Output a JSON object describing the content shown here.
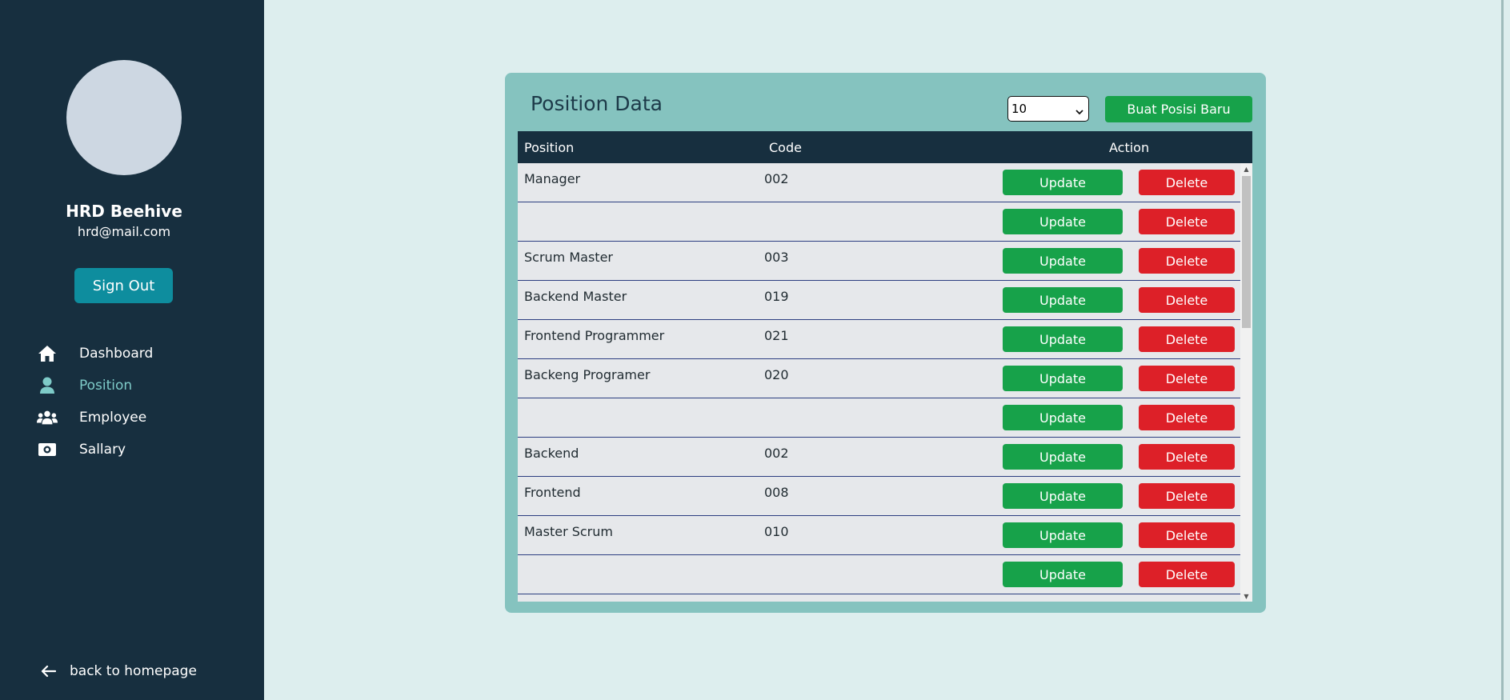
{
  "sidebar": {
    "user_name": "HRD Beehive",
    "user_email": "hrd@mail.com",
    "signout_label": "Sign Out",
    "nav": [
      {
        "label": "Dashboard",
        "icon": "home-icon",
        "active": false
      },
      {
        "label": "Position",
        "icon": "user-icon",
        "active": true
      },
      {
        "label": "Employee",
        "icon": "users-icon",
        "active": false
      },
      {
        "label": "Sallary",
        "icon": "money-icon",
        "active": false
      }
    ],
    "back_label": "back to homepage"
  },
  "main": {
    "title": "Position Data",
    "page_size": "10",
    "create_label": "Buat Posisi Baru",
    "columns": {
      "position": "Position",
      "code": "Code",
      "action": "Action"
    },
    "update_label": "Update",
    "delete_label": "Delete",
    "rows": [
      {
        "position": "Manager",
        "code": "002"
      },
      {
        "position": "",
        "code": ""
      },
      {
        "position": "Scrum Master",
        "code": "003"
      },
      {
        "position": "Backend Master",
        "code": "019"
      },
      {
        "position": "Frontend Programmer",
        "code": "021"
      },
      {
        "position": "Backeng Programer",
        "code": "020"
      },
      {
        "position": "",
        "code": ""
      },
      {
        "position": "Backend",
        "code": "002"
      },
      {
        "position": "Frontend",
        "code": "008"
      },
      {
        "position": "Master Scrum",
        "code": "010"
      },
      {
        "position": "",
        "code": ""
      }
    ]
  },
  "colors": {
    "sidebar_bg": "#172f3f",
    "page_bg": "#ddeeee",
    "card_bg": "#85c3bf",
    "update_green": "#17a24a",
    "delete_red": "#dd2028",
    "signout_teal": "#0e8d9e",
    "active_nav": "#7ecbc8"
  }
}
